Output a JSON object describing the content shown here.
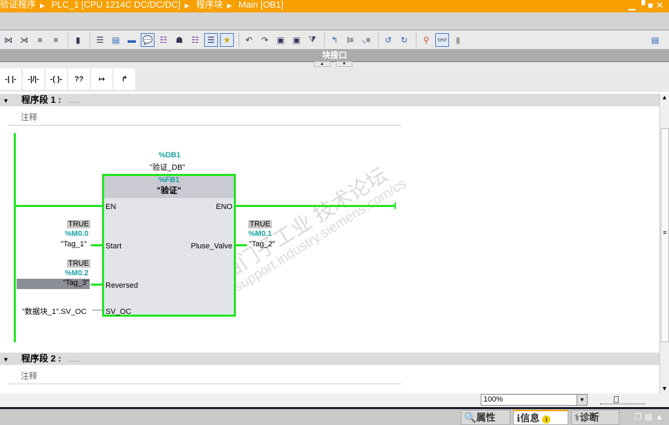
{
  "breadcrumb": [
    "验证程序",
    "PLC_1 [CPU 1214C DC/DC/DC]",
    "程序块",
    "Main [OB1]"
  ],
  "window_controls": {
    "minimize": "▁",
    "restore": "▝",
    "maximize": "■",
    "close": "✕"
  },
  "toolbar_icons": [
    "insert-network-icon",
    "delete-network-icon",
    "insert-row-icon",
    "add-row-icon",
    "db-icon",
    "network-view-icon",
    "abs-view-icon",
    "fbd-view-icon",
    "comment-icon",
    "tag-info-icon",
    "tag-info2-icon",
    "tag-info3-icon",
    "show-list-icon",
    "favorites-icon",
    "goto-prev-error-icon",
    "goto-next-error-icon",
    "open-block-icon",
    "close-block-icon",
    "compare-icon",
    "call-hierarchy-icon",
    "assign-icon",
    "unassign-icon",
    "prev-bookmark-icon",
    "next-bookmark-icon",
    "monitor-icon",
    "glasses-monitor-icon",
    "db-lock-icon",
    "layout-icon"
  ],
  "interface_bar": "块接口",
  "lad_elements": [
    "-| |-",
    "-|/|-",
    "-( )-",
    "??",
    "↦",
    "↱"
  ],
  "networks": [
    {
      "title": "程序段 1 :",
      "dots": "......",
      "comment": "注释"
    },
    {
      "title": "程序段 2 :",
      "dots": "......",
      "comment": "注释"
    }
  ],
  "block": {
    "db_addr": "%DB1",
    "db_name": "\"验证_DB\"",
    "fb_addr": "%FB1",
    "fb_name": "\"验证\"",
    "pins": {
      "en": "EN",
      "eno": "ENO",
      "start": "Start",
      "reversed": "Reversed",
      "sv_oc": "SV_OC",
      "pluse_valve": "Pluse_Valve"
    }
  },
  "operands": {
    "start": {
      "value": "TRUE",
      "addr": "%M0.0",
      "tag": "\"Tag_1\""
    },
    "reversed": {
      "value": "TRUE",
      "addr": "%M0.2",
      "tag": "\"Tag_3\""
    },
    "sv_oc": {
      "tag": "\"数据块_1\".SV_OC"
    },
    "pluse_valve": {
      "value": "TRUE",
      "addr": "%M0.1",
      "tag": "\"Tag_2\""
    }
  },
  "zoom": {
    "value": "100%"
  },
  "bottom_tabs": [
    {
      "label": "属性"
    },
    {
      "label": "信息"
    },
    {
      "label": "诊断"
    }
  ],
  "watermark": "西门子工业 技术论坛 support.industry.siemens.com/cs",
  "colors": {
    "title_bar": "#f7a000",
    "rung": "#1ee61e",
    "teal": "#1aa3a3"
  }
}
